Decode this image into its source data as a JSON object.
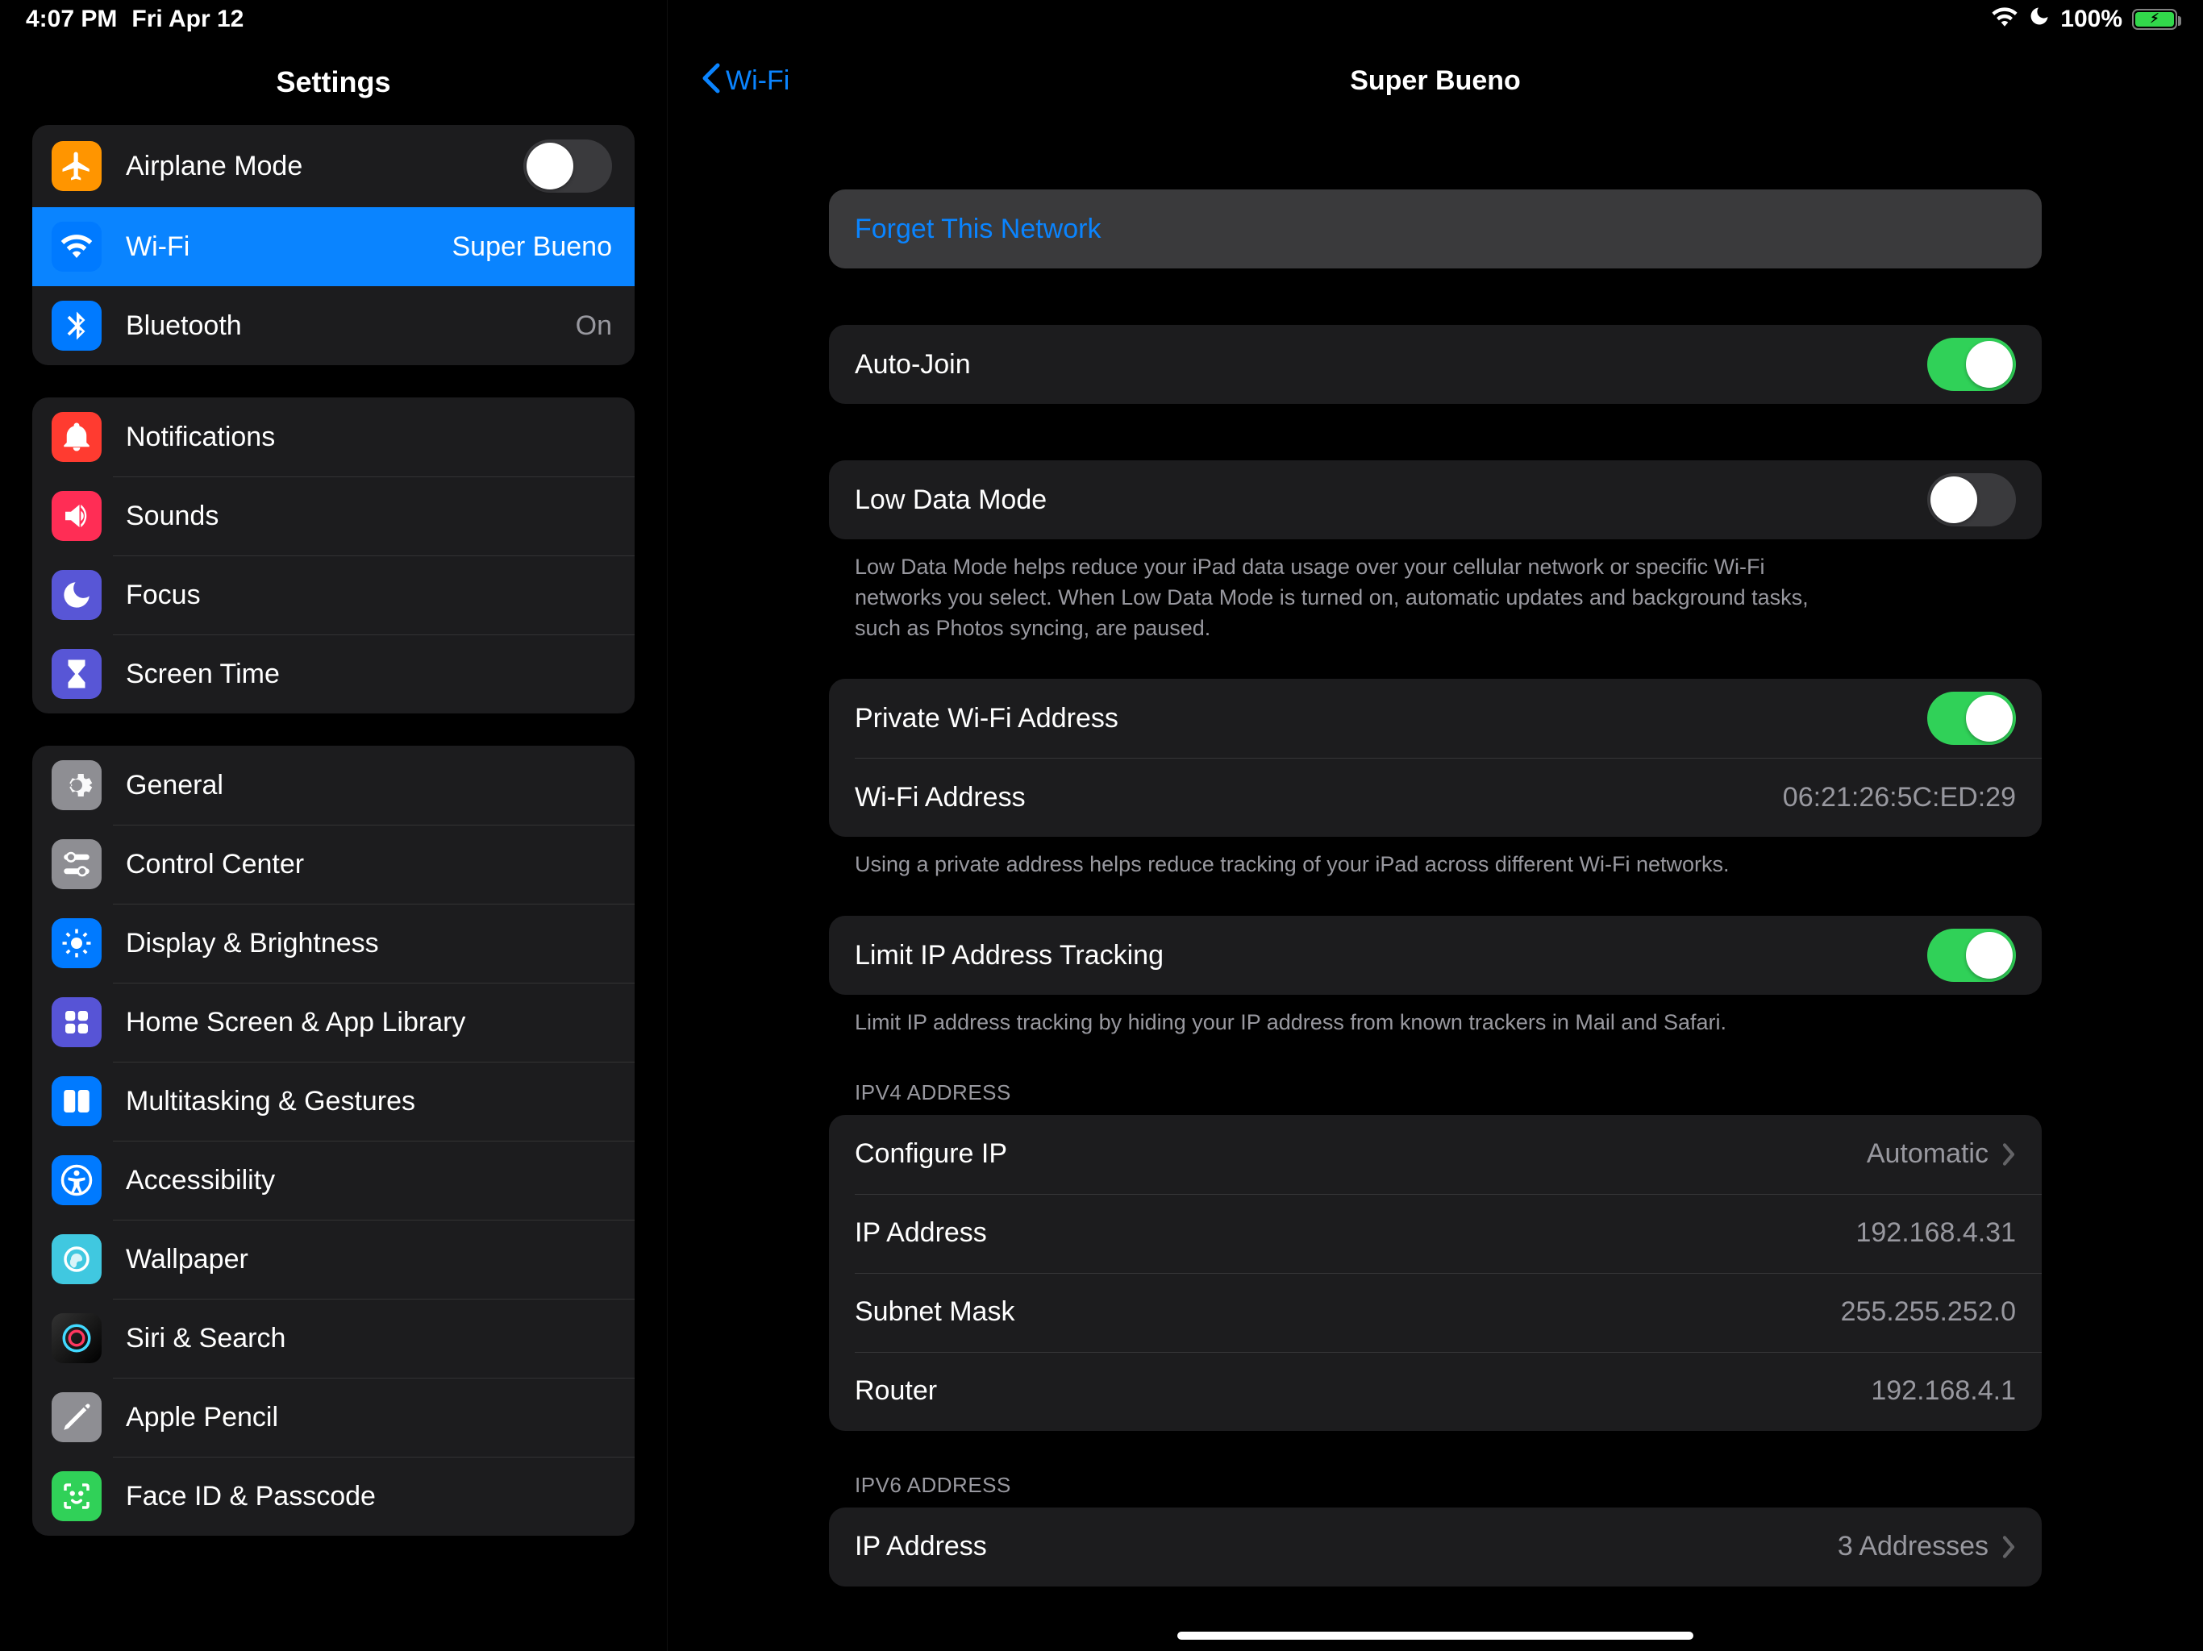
{
  "status": {
    "time": "4:07 PM",
    "date": "Fri Apr 12",
    "battery": "100%"
  },
  "sidebar": {
    "title": "Settings",
    "g1": {
      "airplane": "Airplane Mode",
      "wifi": "Wi-Fi",
      "wifi_val": "Super Bueno",
      "bt": "Bluetooth",
      "bt_val": "On"
    },
    "g2": {
      "notif": "Notifications",
      "sounds": "Sounds",
      "focus": "Focus",
      "screentime": "Screen Time"
    },
    "g3": {
      "general": "General",
      "cc": "Control Center",
      "display": "Display & Brightness",
      "home": "Home Screen & App Library",
      "multi": "Multitasking & Gestures",
      "access": "Accessibility",
      "wallpaper": "Wallpaper",
      "siri": "Siri & Search",
      "pencil": "Apple Pencil",
      "faceid": "Face ID & Passcode"
    }
  },
  "detail": {
    "back": "Wi-Fi",
    "title": "Super Bueno",
    "forget": "Forget This Network",
    "autojoin": "Auto-Join",
    "lowdata": "Low Data Mode",
    "lowdata_help": "Low Data Mode helps reduce your iPad data usage over your cellular network or specific Wi-Fi networks you select. When Low Data Mode is turned on, automatic updates and background tasks, such as Photos syncing, are paused.",
    "private": "Private Wi-Fi Address",
    "wifiaddr_label": "Wi-Fi Address",
    "wifiaddr": "06:21:26:5C:ED:29",
    "private_help": "Using a private address helps reduce tracking of your iPad across different Wi-Fi networks.",
    "limitip": "Limit IP Address Tracking",
    "limitip_help": "Limit IP address tracking by hiding your IP address from known trackers in Mail and Safari.",
    "ipv4_header": "IPV4 ADDRESS",
    "configip": "Configure IP",
    "configip_val": "Automatic",
    "ipaddr_label": "IP Address",
    "ipaddr": "192.168.4.31",
    "subnet_label": "Subnet Mask",
    "subnet": "255.255.252.0",
    "router_label": "Router",
    "router": "192.168.4.1",
    "ipv6_header": "IPV6 ADDRESS",
    "ipv6_ip_label": "IP Address",
    "ipv6_ip_val": "3 Addresses"
  }
}
